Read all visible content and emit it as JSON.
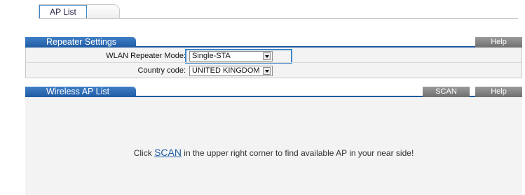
{
  "tabs": {
    "ap_list": "AP List"
  },
  "repeater": {
    "title": "Repeater Settings",
    "help": "Help",
    "fields": {
      "mode_label": "WLAN Repeater Mode:",
      "mode_value": "Single-STA",
      "country_label": "Country code:",
      "country_value": "UNITED KINGDOM"
    }
  },
  "wireless_ap_list": {
    "title": "Wireless AP List",
    "scan": "SCAN",
    "help": "Help",
    "hint_prefix": "Click ",
    "hint_link": "SCAN",
    "hint_suffix": " in the upper right corner to find available AP in your near side!"
  }
}
